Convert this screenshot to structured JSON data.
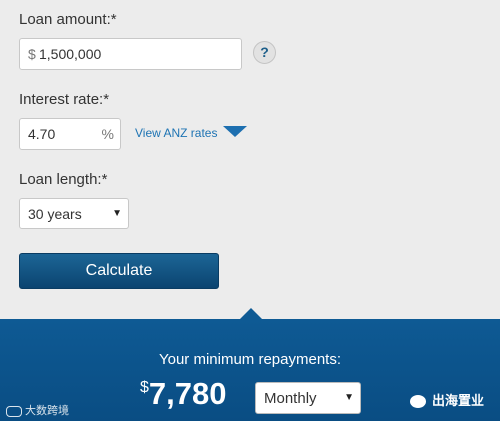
{
  "form": {
    "loan_amount": {
      "label": "Loan amount:*",
      "currency": "$",
      "value": "1,500,000",
      "help": "?"
    },
    "interest_rate": {
      "label": "Interest rate:*",
      "value": "4.70",
      "unit": "%",
      "link": "View ANZ rates"
    },
    "loan_length": {
      "label": "Loan length:*",
      "selected": "30 years"
    },
    "calculate_label": "Calculate"
  },
  "result": {
    "title": "Your minimum repayments:",
    "currency": "$",
    "amount": "7,780",
    "frequency": "Monthly"
  },
  "watermarks": {
    "left": "大数跨境",
    "right": "出海置业"
  },
  "colors": {
    "accent": "#0b4f86",
    "link": "#1d73b3",
    "background": "#ececec"
  }
}
